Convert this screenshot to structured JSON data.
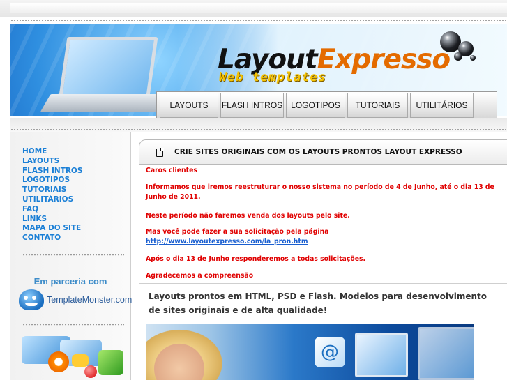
{
  "header": {
    "logo_part1": "Layout",
    "logo_part2": "Expresso",
    "tagline": "Web templates"
  },
  "nav": {
    "items": [
      "LAYOUTS",
      "FLASH INTROS",
      "LOGOTIPOS",
      "TUTORIAIS",
      "UTILITÁRIOS"
    ]
  },
  "sidebar": {
    "menu": [
      "HOME",
      "LAYOUTS",
      "FLASH INTROS",
      "LOGOTIPOS",
      "TUTORIAIS",
      "UTILITÁRIOS",
      "FAQ",
      "LINKS",
      "MAPA DO SITE",
      "CONTATO"
    ],
    "partner_heading": "Em parceria com",
    "partner_name": "TemplateMonster.com"
  },
  "content": {
    "panel_title": "CRIE SITES ORIGINAIS COM OS LAYOUTS PRONTOS LAYOUT EXPRESSO",
    "notice": {
      "greeting": "Caros clientes",
      "p1": "Informamos que iremos reestruturar o nosso sistema no período de 4 de Junho, até o dia 13 de Junho de 2011.",
      "p2": "Neste período não faremos venda dos layouts pelo site.",
      "p3": "Mas você pode fazer a sua solicitação pela página",
      "link": "http://www.layoutexpresso.com/la_pron.htm",
      "p4": "Após o dia 13 de Junho responderemos a todas solicitações.",
      "p5": "Agradecemos a compreensão"
    },
    "intro": "Layouts prontos em HTML, PSD e Flash. Modelos para desenvolvimento de sites originais e de alta qualidade!",
    "photo_at_symbol": "@"
  },
  "colors": {
    "menu_link": "#1a7fd6",
    "notice_red": "#e00000",
    "logo_orange": "#e46b00",
    "tagline_yellow": "#f6c300",
    "header_blue": "#0b4fb3"
  }
}
